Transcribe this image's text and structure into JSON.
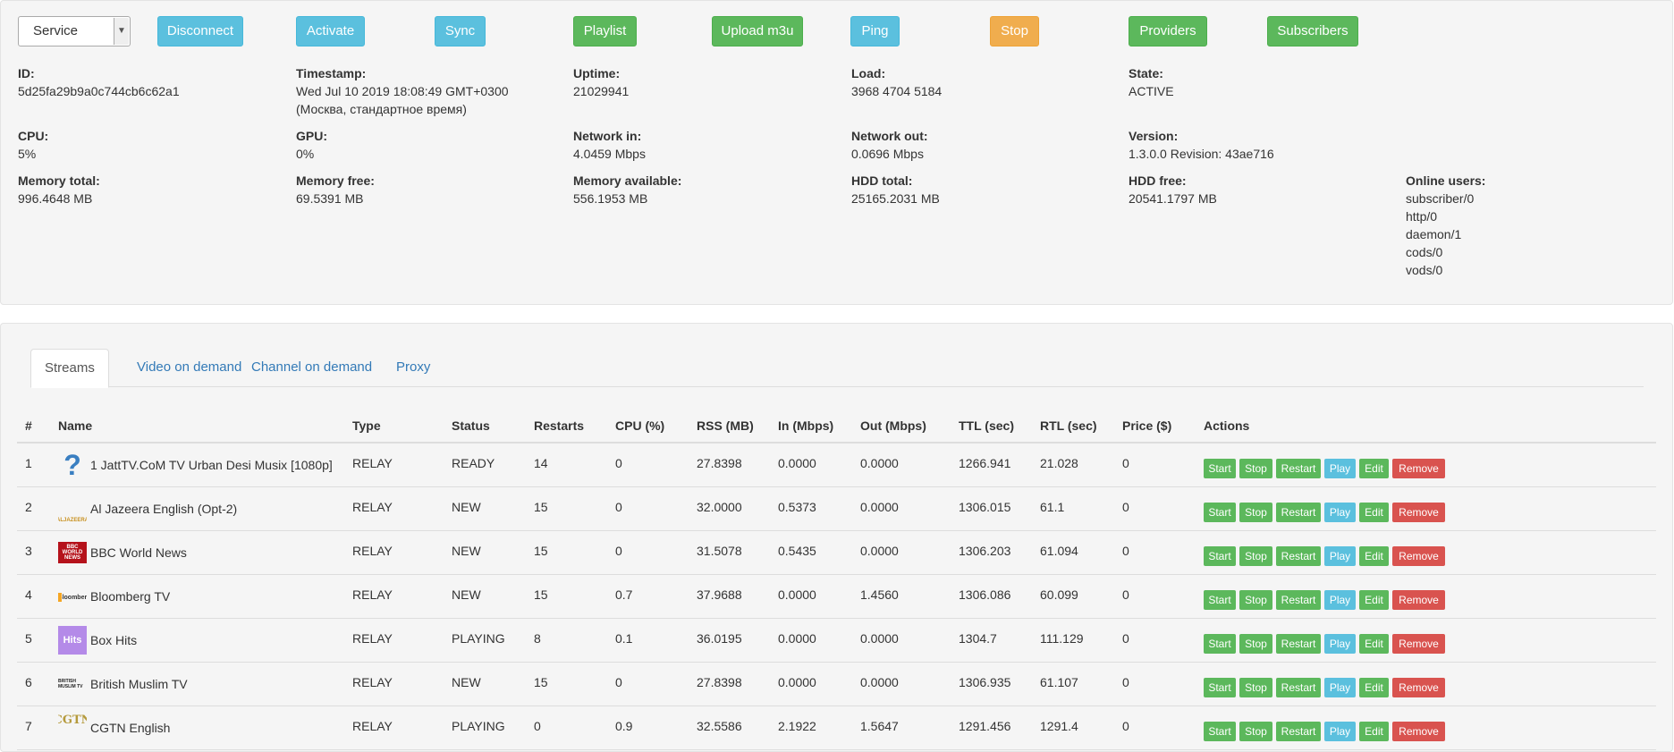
{
  "toolbar": {
    "service_select": "Service",
    "buttons": {
      "disconnect": "Disconnect",
      "activate": "Activate",
      "sync": "Sync",
      "playlist": "Playlist",
      "upload": "Upload m3u",
      "ping": "Ping",
      "stop": "Stop",
      "providers": "Providers",
      "subscribers": "Subscribers"
    }
  },
  "stats": {
    "id": {
      "label": "ID:",
      "value": "5d25fa29b9a0c744cb6c62a1"
    },
    "timestamp": {
      "label": "Timestamp:",
      "value": "Wed Jul 10 2019 18:08:49 GMT+0300\n(Москва, стандартное время)"
    },
    "uptime": {
      "label": "Uptime:",
      "value": "21029941"
    },
    "load": {
      "label": "Load:",
      "value": "3968 4704 5184"
    },
    "state": {
      "label": "State:",
      "value": "ACTIVE"
    },
    "cpu": {
      "label": "CPU:",
      "value": "5%"
    },
    "gpu": {
      "label": "GPU:",
      "value": "0%"
    },
    "network_in": {
      "label": "Network in:",
      "value": "4.0459 Mbps"
    },
    "network_out": {
      "label": "Network out:",
      "value": "0.0696 Mbps"
    },
    "version": {
      "label": "Version:",
      "value": "1.3.0.0 Revision: 43ae716"
    },
    "memory_total": {
      "label": "Memory total:",
      "value": "996.4648 MB"
    },
    "memory_free": {
      "label": "Memory free:",
      "value": "69.5391 MB"
    },
    "memory_available": {
      "label": "Memory available:",
      "value": "556.1953 MB"
    },
    "hdd_total": {
      "label": "HDD total:",
      "value": "25165.2031 MB"
    },
    "hdd_free": {
      "label": "HDD free:",
      "value": "20541.1797 MB"
    },
    "online_users": {
      "label": "Online users:",
      "value": "subscriber/0\nhttp/0\ndaemon/1\ncods/0\nvods/0"
    }
  },
  "tabs": [
    "Streams",
    "Video on demand",
    "Channel on demand",
    "Proxy"
  ],
  "table": {
    "headers": [
      "#",
      "Name",
      "Type",
      "Status",
      "Restarts",
      "CPU (%)",
      "RSS (MB)",
      "In (Mbps)",
      "Out (Mbps)",
      "TTL (sec)",
      "RTL (sec)",
      "Price ($)",
      "Actions"
    ],
    "action_labels": [
      "Start",
      "Stop",
      "Restart",
      "Play",
      "Edit",
      "Remove"
    ],
    "rows": [
      {
        "num": "1",
        "name": "1 JattTV.CoM TV Urban Desi Musix [1080p]",
        "logo": "?",
        "type": "RELAY",
        "status": "READY",
        "restarts": "14",
        "cpu": "0",
        "rss": "27.8398",
        "in": "0.0000",
        "out": "0.0000",
        "ttl": "1266.941",
        "rtl": "21.028",
        "price": "0"
      },
      {
        "num": "2",
        "name": "Al Jazeera English (Opt-2)",
        "logo": "ALJAZEERA",
        "type": "RELAY",
        "status": "NEW",
        "restarts": "15",
        "cpu": "0",
        "rss": "32.0000",
        "in": "0.5373",
        "out": "0.0000",
        "ttl": "1306.015",
        "rtl": "61.1",
        "price": "0"
      },
      {
        "num": "3",
        "name": "BBC World News",
        "logo": "BBC WORLD NEWS",
        "type": "RELAY",
        "status": "NEW",
        "restarts": "15",
        "cpu": "0",
        "rss": "31.5078",
        "in": "0.5435",
        "out": "0.0000",
        "ttl": "1306.203",
        "rtl": "61.094",
        "price": "0"
      },
      {
        "num": "4",
        "name": "Bloomberg TV",
        "logo": "Bloomberg",
        "type": "RELAY",
        "status": "NEW",
        "restarts": "15",
        "cpu": "0.7",
        "rss": "37.9688",
        "in": "0.0000",
        "out": "1.4560",
        "ttl": "1306.086",
        "rtl": "60.099",
        "price": "0"
      },
      {
        "num": "5",
        "name": "Box Hits",
        "logo": "Hits",
        "type": "RELAY",
        "status": "PLAYING",
        "restarts": "8",
        "cpu": "0.1",
        "rss": "36.0195",
        "in": "0.0000",
        "out": "0.0000",
        "ttl": "1304.7",
        "rtl": "111.129",
        "price": "0"
      },
      {
        "num": "6",
        "name": "British Muslim TV",
        "logo": "BRITISH MUSLIM TV",
        "type": "RELAY",
        "status": "NEW",
        "restarts": "15",
        "cpu": "0",
        "rss": "27.8398",
        "in": "0.0000",
        "out": "0.0000",
        "ttl": "1306.935",
        "rtl": "61.107",
        "price": "0"
      },
      {
        "num": "7",
        "name": "CGTN English",
        "logo": "CGTN",
        "type": "RELAY",
        "status": "PLAYING",
        "restarts": "0",
        "cpu": "0.9",
        "rss": "32.5586",
        "in": "2.1922",
        "out": "1.5647",
        "ttl": "1291.456",
        "rtl": "1291.4",
        "price": "0"
      }
    ]
  },
  "colors": {
    "info": "#5bc0de",
    "success": "#5cb85c",
    "warning": "#f0ad4e",
    "danger": "#d9534f",
    "link": "#337ab7"
  }
}
